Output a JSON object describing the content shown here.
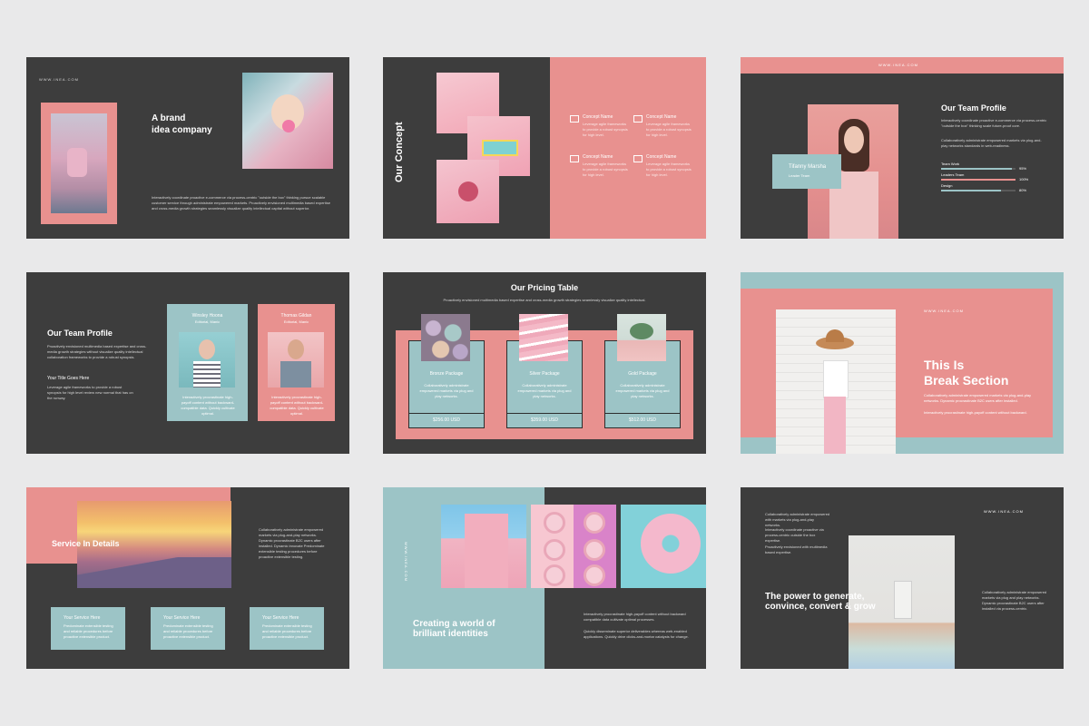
{
  "colors": {
    "dark": "#3d3d3d",
    "pink": "#e8918f",
    "teal": "#9cc4c6",
    "page": "#e9e9ea"
  },
  "s1": {
    "url": "WWW.INEA.COM",
    "title_l1": "A brand",
    "title_l2": "idea company",
    "body": "Interactively coordinate proactive e-commerce via process-centric \"outside the box\" thinking pursue scalable customer service through administrate empowered markets. Proactively envisioned multimedia based expertise and cross-media growth strategies seamlessly visualize quality intellectual capital without superior."
  },
  "s2": {
    "title": "Our Concept",
    "items": [
      {
        "label": "Concept Name",
        "body": "Leverage agile frameworks to provide a robust synopsis for high level."
      },
      {
        "label": "Concept Name",
        "body": "Leverage agile frameworks to provide a robust synopsis for high level."
      },
      {
        "label": "Concept Name",
        "body": "Leverage agile frameworks to provide a robust synopsis for high level."
      },
      {
        "label": "Concept Name",
        "body": "Leverage agile frameworks to provide a robust synopsis for high level."
      }
    ]
  },
  "s3": {
    "url": "WWW.INEA.COM",
    "title": "Our Team Profile",
    "body1": "Interactively coordinate proactive e-commerce via process-centric \"outside the box\" thinking scale future-proof core.",
    "body2": "Collaboratively administrate empowered markets via plug-and-play networks standards in web-readiness.",
    "name": "Tifanny Marsha",
    "role": "Leader Team",
    "skills": [
      {
        "label": "Team Work",
        "value": "95%",
        "pct": 95
      },
      {
        "label": "Leaders Team",
        "value": "100%",
        "pct": 100
      },
      {
        "label": "Design",
        "value": "80%",
        "pct": 80
      }
    ]
  },
  "s4": {
    "title": "Our Team Profile",
    "body": "Proactively envisioned multimedia based expertise and cross-media growth strategies without visualize quality intellectual collaboration frameworks to provide a robust synopsis.",
    "subtitle": "Your Title Goes Here",
    "subbody": "Leverage agile frameworks to provide a robust synopsis for high level review new normal that has on the runway.",
    "cards": [
      {
        "name": "Winsley Hoona",
        "role": "Editorial, Manic",
        "body": "Interactively procrastinate high-payoff content without backward-compatible data. Quickly cultivate optimal."
      },
      {
        "name": "Thomas Gildan",
        "role": "Editorial, Manic",
        "body": "Interactively procrastinate high-payoff content without backward-compatible data. Quickly cultivate optimal."
      }
    ]
  },
  "s5": {
    "title": "Our Pricing Table",
    "subtitle": "Proactively envisioned multimedia based expertise and cross-media growth strategies seamlessly visualize quality intellectual.",
    "packages": [
      {
        "name": "Bronze Package",
        "body": "Collaboratively administrate empowered markets via plug and play networks.",
        "price": "$256.00 USD"
      },
      {
        "name": "Silver Package",
        "body": "Collaboratively administrate empowered markets via plug and play networks.",
        "price": "$359.00 USD"
      },
      {
        "name": "Gold Package",
        "body": "Collaboratively administrate empowered markets via plug and play networks.",
        "price": "$512.00 USD"
      }
    ]
  },
  "s6": {
    "url": "WWW.INEA.COM",
    "title_l1": "This Is",
    "title_l2": "Break Section",
    "body1": "Collaboratively administrate empowered markets via plug-and-play networks. Dynamic procrastinate B2C users after installed.",
    "body2": "Interactively procrastinate high-payoff content without backward."
  },
  "s7": {
    "title": "Service In Details",
    "body": "Collaboratively administrate empowered markets via plug-and-play networks. Dynamic procrastinate B2C users after installed. Dynamic innovate Predominate extensible testing procedures before proactive extensible testing.",
    "services": [
      {
        "label": "Your Service Here",
        "body": "Predominate extensible testing and reliable procedures before proactive extensible product."
      },
      {
        "label": "Your Service Here",
        "body": "Predominate extensible testing and reliable procedures before proactive extensible product."
      },
      {
        "label": "Your Service Here",
        "body": "Predominate extensible testing and reliable procedures before proactive extensible product."
      }
    ]
  },
  "s8": {
    "url": "WWW.INEA.COM",
    "title_l1": "Creating a world of",
    "title_l2": "brilliant identities",
    "body1": "Interactively procrastinate high-payoff content without backward compatible data cultivate optimal processes.",
    "body2": "Quickly disseminate superior deliverables whereas web-enabled applications. Quickly drive clicks-and-mortar catalysts for change."
  },
  "s9": {
    "url": "WWW.INEA.COM",
    "body1": "Collaboratively administrate empowered with markets via plug-and-play networks.",
    "body2": "Interactively coordinate proactive via process-centric outside the box expertise.",
    "body3": "Proactively envisioned with multimedia based expertise.",
    "title_l1": "The power to generate,",
    "title_l2": "convince, convert & grow",
    "right": "Collaboratively administrate empowered markets via plug and play networks. Dynamic procrastinate B2C users after installed via process-centric."
  }
}
